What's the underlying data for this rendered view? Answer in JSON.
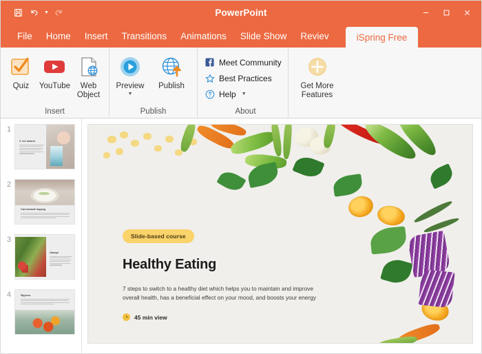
{
  "window": {
    "app_title": "PowerPoint",
    "accent_color": "#ec6941",
    "quick_access": [
      {
        "name": "save",
        "icon": "save-icon"
      },
      {
        "name": "undo",
        "icon": "undo-icon"
      },
      {
        "name": "redo",
        "icon": "redo-icon"
      }
    ],
    "controls": [
      {
        "name": "minimize",
        "icon": "minimize-icon"
      },
      {
        "name": "maximize",
        "icon": "maximize-icon"
      },
      {
        "name": "close",
        "icon": "close-icon"
      }
    ]
  },
  "tabs": [
    {
      "label": "File",
      "active": false
    },
    {
      "label": "Home",
      "active": false
    },
    {
      "label": "Insert",
      "active": false
    },
    {
      "label": "Transitions",
      "active": false
    },
    {
      "label": "Animations",
      "active": false
    },
    {
      "label": "Slide Show",
      "active": false
    },
    {
      "label": "Reviev",
      "active": false
    },
    {
      "label": "iSpring Free",
      "active": true
    }
  ],
  "ribbon": {
    "groups": [
      {
        "label": "Insert",
        "buttons": [
          {
            "label": "Quiz",
            "icon": "quiz-checkbox-icon"
          },
          {
            "label": "YouTube",
            "icon": "youtube-icon"
          },
          {
            "label": "Web\nObject",
            "icon": "web-object-icon"
          }
        ]
      },
      {
        "label": "Publish",
        "buttons": [
          {
            "label": "Preview",
            "icon": "preview-play-icon",
            "has_dropdown": true
          },
          {
            "label": "Publish",
            "icon": "publish-globe-upload-icon",
            "has_dropdown": false
          }
        ]
      },
      {
        "label": "About",
        "links": [
          {
            "label": "Meet Community",
            "icon": "facebook-icon"
          },
          {
            "label": "Best Practices",
            "icon": "star-icon"
          },
          {
            "label": "Help",
            "icon": "help-question-icon",
            "has_dropdown": true
          }
        ]
      },
      {
        "label": "",
        "buttons": [
          {
            "label": "Get More\nFeatures",
            "icon": "plus-circle-icon"
          }
        ]
      }
    ],
    "labels": {
      "quiz": "Quiz",
      "youtube": "YouTube",
      "web_object_line1": "Web",
      "web_object_line2": "Object",
      "preview": "Preview",
      "publish": "Publish",
      "meet_community": "Meet Community",
      "best_practices": "Best Practices",
      "help": "Help",
      "get_more_line1": "Get More",
      "get_more_line2": "Features",
      "group_insert": "Insert",
      "group_publish": "Publish",
      "group_about": "About"
    }
  },
  "thumbnails": [
    {
      "number": "1",
      "title": "С его начать",
      "selected": false
    },
    {
      "number": "2",
      "title": "Системный подход",
      "selected": false
    },
    {
      "number": "3",
      "title": "Овощи",
      "selected": false
    },
    {
      "number": "4",
      "title": "Фрукты",
      "selected": false
    }
  ],
  "slide": {
    "badge": "Slide-based course",
    "title": "Healthy Eating",
    "description": "7 steps to switch to a healthy diet which helps you to maintain and improve overall health, has a beneficial effect on your mood, and boosts your energy",
    "duration": "45 min view",
    "badge_color": "#fbd36b"
  }
}
